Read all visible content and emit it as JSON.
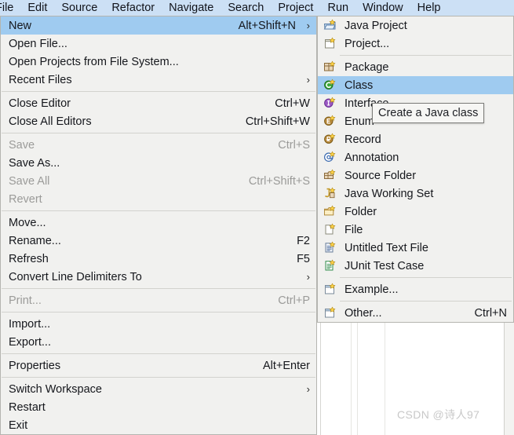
{
  "menubar": {
    "items": [
      {
        "label": "File"
      },
      {
        "label": "Edit"
      },
      {
        "label": "Source"
      },
      {
        "label": "Refactor"
      },
      {
        "label": "Navigate"
      },
      {
        "label": "Search"
      },
      {
        "label": "Project"
      },
      {
        "label": "Run"
      },
      {
        "label": "Window"
      },
      {
        "label": "Help"
      }
    ]
  },
  "file_menu": {
    "rows": [
      {
        "type": "item",
        "label": "New",
        "accel": "Alt+Shift+N",
        "arrow": "›",
        "selected": true,
        "disabled": false
      },
      {
        "type": "item",
        "label": "Open File...",
        "accel": "",
        "arrow": "",
        "selected": false,
        "disabled": false
      },
      {
        "type": "item",
        "label": "Open Projects from File System...",
        "accel": "",
        "arrow": "",
        "selected": false,
        "disabled": false
      },
      {
        "type": "item",
        "label": "Recent Files",
        "accel": "",
        "arrow": "›",
        "selected": false,
        "disabled": false
      },
      {
        "type": "sep"
      },
      {
        "type": "item",
        "label": "Close Editor",
        "accel": "Ctrl+W",
        "arrow": "",
        "selected": false,
        "disabled": false
      },
      {
        "type": "item",
        "label": "Close All Editors",
        "accel": "Ctrl+Shift+W",
        "arrow": "",
        "selected": false,
        "disabled": false
      },
      {
        "type": "sep"
      },
      {
        "type": "item",
        "label": "Save",
        "accel": "Ctrl+S",
        "arrow": "",
        "selected": false,
        "disabled": true
      },
      {
        "type": "item",
        "label": "Save As...",
        "accel": "",
        "arrow": "",
        "selected": false,
        "disabled": false
      },
      {
        "type": "item",
        "label": "Save All",
        "accel": "Ctrl+Shift+S",
        "arrow": "",
        "selected": false,
        "disabled": true
      },
      {
        "type": "item",
        "label": "Revert",
        "accel": "",
        "arrow": "",
        "selected": false,
        "disabled": true
      },
      {
        "type": "sep"
      },
      {
        "type": "item",
        "label": "Move...",
        "accel": "",
        "arrow": "",
        "selected": false,
        "disabled": false
      },
      {
        "type": "item",
        "label": "Rename...",
        "accel": "F2",
        "arrow": "",
        "selected": false,
        "disabled": false
      },
      {
        "type": "item",
        "label": "Refresh",
        "accel": "F5",
        "arrow": "",
        "selected": false,
        "disabled": false
      },
      {
        "type": "item",
        "label": "Convert Line Delimiters To",
        "accel": "",
        "arrow": "›",
        "selected": false,
        "disabled": false
      },
      {
        "type": "sep"
      },
      {
        "type": "item",
        "label": "Print...",
        "accel": "Ctrl+P",
        "arrow": "",
        "selected": false,
        "disabled": true
      },
      {
        "type": "sep"
      },
      {
        "type": "item",
        "label": "Import...",
        "accel": "",
        "arrow": "",
        "selected": false,
        "disabled": false
      },
      {
        "type": "item",
        "label": "Export...",
        "accel": "",
        "arrow": "",
        "selected": false,
        "disabled": false
      },
      {
        "type": "sep"
      },
      {
        "type": "item",
        "label": "Properties",
        "accel": "Alt+Enter",
        "arrow": "",
        "selected": false,
        "disabled": false
      },
      {
        "type": "sep"
      },
      {
        "type": "item",
        "label": "Switch Workspace",
        "accel": "",
        "arrow": "›",
        "selected": false,
        "disabled": false
      },
      {
        "type": "item",
        "label": "Restart",
        "accel": "",
        "arrow": "",
        "selected": false,
        "disabled": false
      },
      {
        "type": "item",
        "label": "Exit",
        "accel": "",
        "arrow": "",
        "selected": false,
        "disabled": false
      }
    ]
  },
  "new_menu": {
    "rows": [
      {
        "type": "item",
        "label": "Java Project",
        "accel": "",
        "icon": "java-project-icon",
        "selected": false
      },
      {
        "type": "item",
        "label": "Project...",
        "accel": "",
        "icon": "project-icon",
        "selected": false
      },
      {
        "type": "sep"
      },
      {
        "type": "item",
        "label": "Package",
        "accel": "",
        "icon": "package-icon",
        "selected": false
      },
      {
        "type": "item",
        "label": "Class",
        "accel": "",
        "icon": "class-icon",
        "selected": true
      },
      {
        "type": "item",
        "label": "Interface",
        "accel": "",
        "icon": "interface-icon",
        "selected": false
      },
      {
        "type": "item",
        "label": "Enum",
        "accel": "",
        "icon": "enum-icon",
        "selected": false
      },
      {
        "type": "item",
        "label": "Record",
        "accel": "",
        "icon": "record-icon",
        "selected": false
      },
      {
        "type": "item",
        "label": "Annotation",
        "accel": "",
        "icon": "annotation-icon",
        "selected": false
      },
      {
        "type": "item",
        "label": "Source Folder",
        "accel": "",
        "icon": "source-folder-icon",
        "selected": false
      },
      {
        "type": "item",
        "label": "Java Working Set",
        "accel": "",
        "icon": "java-working-set-icon",
        "selected": false
      },
      {
        "type": "item",
        "label": "Folder",
        "accel": "",
        "icon": "folder-icon",
        "selected": false
      },
      {
        "type": "item",
        "label": "File",
        "accel": "",
        "icon": "file-icon",
        "selected": false
      },
      {
        "type": "item",
        "label": "Untitled Text File",
        "accel": "",
        "icon": "text-file-icon",
        "selected": false
      },
      {
        "type": "item",
        "label": "JUnit Test Case",
        "accel": "",
        "icon": "junit-icon",
        "selected": false
      },
      {
        "type": "sep"
      },
      {
        "type": "item",
        "label": "Example...",
        "accel": "",
        "icon": "example-icon",
        "selected": false
      },
      {
        "type": "sep"
      },
      {
        "type": "item",
        "label": "Other...",
        "accel": "Ctrl+N",
        "icon": "other-icon",
        "selected": false
      }
    ]
  },
  "tooltip": {
    "text": "Create a Java class"
  },
  "watermark": {
    "text": "CSDN @诗人97"
  },
  "colors": {
    "menubar_bg": "#cce0f5",
    "menu_bg": "#f1f1ef",
    "menu_border": "#b5b5b0",
    "selection": "#9fcbf0",
    "text": "#15171c",
    "disabled_text": "#9b9b99",
    "separator": "#d2d2ce",
    "tooltip_bg": "#f6f6f4",
    "tooltip_border": "#7b7b78",
    "watermark": "#c8c8c8"
  }
}
